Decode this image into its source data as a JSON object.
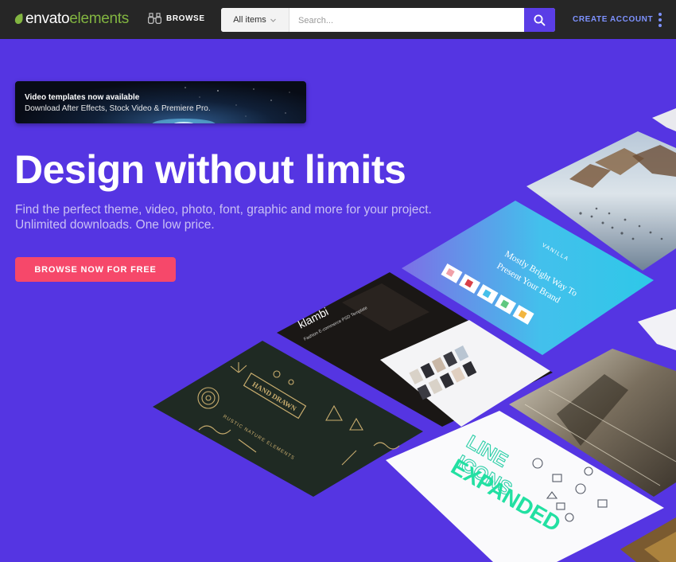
{
  "brand": {
    "name_part1": "envato",
    "name_part2": "elements",
    "accent": "#82b541"
  },
  "nav": {
    "browse_label": "BROWSE",
    "search": {
      "category": "All items",
      "placeholder": "Search..."
    },
    "create_account": "CREATE ACCOUNT"
  },
  "banner": {
    "title": "Video templates now available",
    "subtitle": "Download After Effects, Stock Video & Premiere Pro."
  },
  "hero": {
    "title": "Design without limits",
    "subtitle_line1": "Find the perfect theme, video, photo, font, graphic and more for your project.",
    "subtitle_line2": "Unlimited downloads. One low price.",
    "cta": "BROWSE NOW FOR FREE"
  },
  "collage": {
    "vanilla_brand": "VANILLA",
    "vanilla_headline_1": "Mostly Bright Way To",
    "vanilla_headline_2": "Present Your Brand",
    "klambi_brand": "klambi",
    "klambi_sub": "Fashion E-commerce PSD Template",
    "nature_badge": "HAND DRAWN",
    "nature_caption": "RUSTIC NATURE ELEMENTS",
    "icons_word1": "LINE",
    "icons_word2": "ICONS",
    "icons_word3": "EXPANDED"
  },
  "colors": {
    "hero_bg": "#5535e2",
    "cta": "#f6486a",
    "search_button": "#5a3de6",
    "create_account": "#7e92ff"
  }
}
